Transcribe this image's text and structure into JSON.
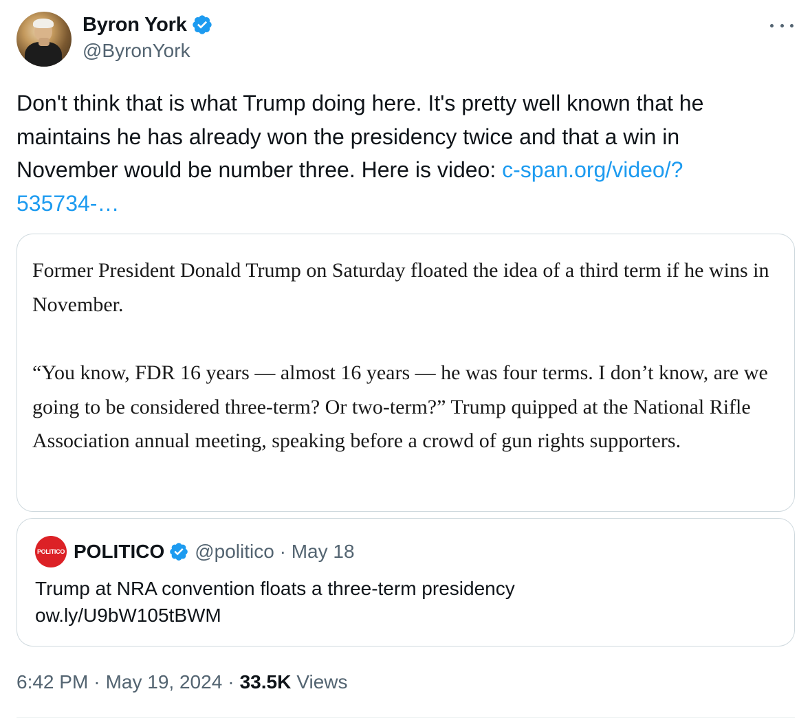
{
  "author": {
    "display_name": "Byron York",
    "handle": "@ByronYork",
    "verified_icon": "verified-badge-icon"
  },
  "tweet": {
    "text_line_1": "Don't think that is what Trump doing here. It's pretty well known that he",
    "text_line_2": "maintains he has already won the presidency twice and that a win in",
    "text_line_3": "November would be number three. Here is video: ",
    "link_part_1": "c-span.org/video/?",
    "link_part_2": "535734-…"
  },
  "quote_image": {
    "paragraph_1": "Former President Donald Trump on Saturday floated the idea of a third term if he wins in November.",
    "paragraph_2": "“You know, FDR 16 years — almost 16 years — he was four terms. I don’t know, are we going to be considered three-term? Or two-term?” Trump quipped at the National Rifle Association annual meeting, speaking before a crowd of gun rights supporters."
  },
  "quoted_tweet": {
    "logo_text": "POLITICO",
    "name": "POLITICO",
    "handle_date": "@politico · May 18",
    "text_line_1": "Trump at NRA convention floats a three-term presidency",
    "text_line_2": "ow.ly/U9bW105tBWM"
  },
  "footer": {
    "time": "6:42 PM",
    "date": "May 19, 2024",
    "separator": "·",
    "views_count": "33.5K",
    "views_label": "Views"
  },
  "colors": {
    "link": "#1d9bf0",
    "verified": "#1d9bf0",
    "politico_red": "#dc2126",
    "secondary_text": "#536471",
    "border": "#cfd9de"
  }
}
